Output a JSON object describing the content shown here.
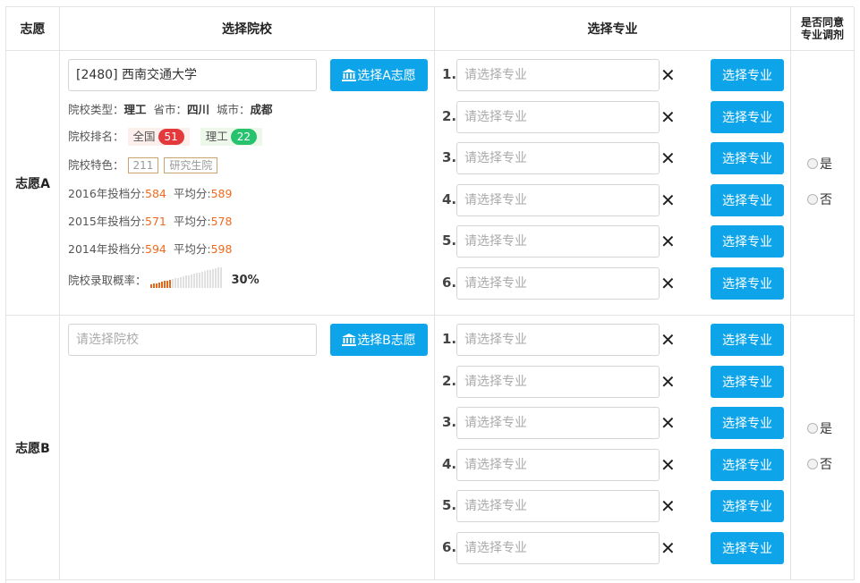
{
  "header": {
    "col_volunteer": "志愿",
    "col_school": "选择院校",
    "col_major": "选择专业",
    "col_adjust_line1": "是否同意",
    "col_adjust_line2": "专业调剂"
  },
  "rows": [
    {
      "label": "志愿A",
      "school_value": "[2480] 西南交通大学",
      "school_button": "选择A志愿",
      "info": {
        "type_label": "院校类型：",
        "type_value": "理工",
        "province_label": "省市：",
        "province_value": "四川",
        "city_label": "城市：",
        "city_value": "成都",
        "rank_label": "院校排名：",
        "rank_national_label": "全国",
        "rank_national_value": "51",
        "rank_type_label": "理工",
        "rank_type_value": "22",
        "feature_label": "院校特色：",
        "feature_tags": [
          "211",
          "研究生院"
        ],
        "scores": [
          {
            "year_label": "2016年投档分:",
            "score": "584",
            "avg_label": "平均分:",
            "avg": "589"
          },
          {
            "year_label": "2015年投档分:",
            "score": "571",
            "avg_label": "平均分:",
            "avg": "578"
          },
          {
            "year_label": "2014年投档分:",
            "score": "594",
            "avg_label": "平均分:",
            "avg": "598"
          }
        ],
        "probability_label": "院校录取概率：",
        "probability_value": "30%",
        "probability": 0.3
      }
    },
    {
      "label": "志愿B",
      "school_placeholder": "请选择院校",
      "school_button": "选择B志愿"
    }
  ],
  "major": {
    "numbers": [
      "1.",
      "2.",
      "3.",
      "4.",
      "5.",
      "6."
    ],
    "placeholder": "请选择专业",
    "remove_glyph": "✕",
    "button": "选择专业"
  },
  "adjust": {
    "yes": "是",
    "no": "否"
  },
  "colors": {
    "accent": "#0ea4ea",
    "orange": "#ef6a1e",
    "red_badge": "#e4393c",
    "green_badge": "#27c26e"
  }
}
